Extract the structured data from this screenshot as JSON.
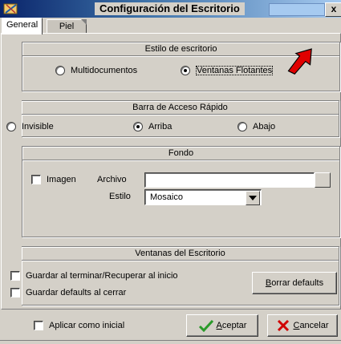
{
  "window": {
    "title": "Configuración del Escritorio",
    "close_glyph": "x"
  },
  "tabs": [
    {
      "label": "General",
      "active": true
    },
    {
      "label": "Piel",
      "active": false
    }
  ],
  "estilo": {
    "heading": "Estilo de escritorio",
    "options": [
      {
        "label": "Multidocumentos",
        "selected": false
      },
      {
        "label": "Ventanas Flotantes",
        "selected": true
      }
    ]
  },
  "barra": {
    "heading": "Barra de Acceso Rápido",
    "options": [
      {
        "label": "Invisible",
        "selected": false
      },
      {
        "label": "Arriba",
        "selected": true
      },
      {
        "label": "Abajo",
        "selected": false
      }
    ]
  },
  "fondo": {
    "heading": "Fondo",
    "imagen_label": "Imagen",
    "archivo_label": "Archivo",
    "archivo_value": "",
    "estilo_label": "Estilo",
    "estilo_value": "Mosaico"
  },
  "ventanas": {
    "heading": "Ventanas del Escritorio",
    "guardar_terminar": "Guardar al terminar/Recuperar al inicio",
    "guardar_defaults": "Guardar defaults al cerrar",
    "borrar_button": "Borrar defaults"
  },
  "footer": {
    "aplicar_label": "Aplicar como inicial",
    "aceptar_button": "Aceptar",
    "cancelar_button": "Cancelar"
  },
  "colors": {
    "title_gradient_start": "#0a246a",
    "title_gradient_end": "#a6caf0",
    "face": "#d4d0c8",
    "arrow": "#e00000",
    "check_green": "#2a9a2a",
    "cancel_red": "#d00000"
  }
}
